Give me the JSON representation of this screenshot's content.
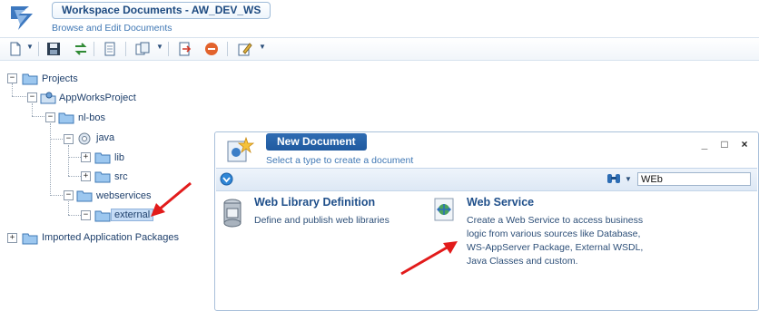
{
  "header": {
    "title": "Workspace Documents - AW_DEV_WS",
    "subtitle": "Browse and Edit Documents"
  },
  "toolbar": {
    "icons": [
      "new-document-icon",
      "save-icon",
      "sync-icon",
      "document-icon",
      "copy-icon",
      "export-icon",
      "stop-icon",
      "edit-icon"
    ]
  },
  "tree": {
    "projects": "Projects",
    "appworks_project": "AppWorksProject",
    "nl_bos": "nl-bos",
    "java": "java",
    "lib": "lib",
    "src": "src",
    "webservices": "webservices",
    "external": "external",
    "imported": "Imported Application Packages"
  },
  "dialog": {
    "title": "New Document",
    "subtitle": "Select a type to create a document",
    "search_value": "WEb",
    "items": [
      {
        "title": "Web Library Definition",
        "description": "Define and publish web libraries"
      },
      {
        "title": "Web Service",
        "description": "Create a Web Service to access business logic from various sources like Database, WS-AppServer Package, External WSDL, Java Classes and custom."
      }
    ]
  },
  "colors": {
    "accent": "#1f5aa0",
    "annotation_arrow": "#e21b1b",
    "selection": "#c6dcf6"
  }
}
